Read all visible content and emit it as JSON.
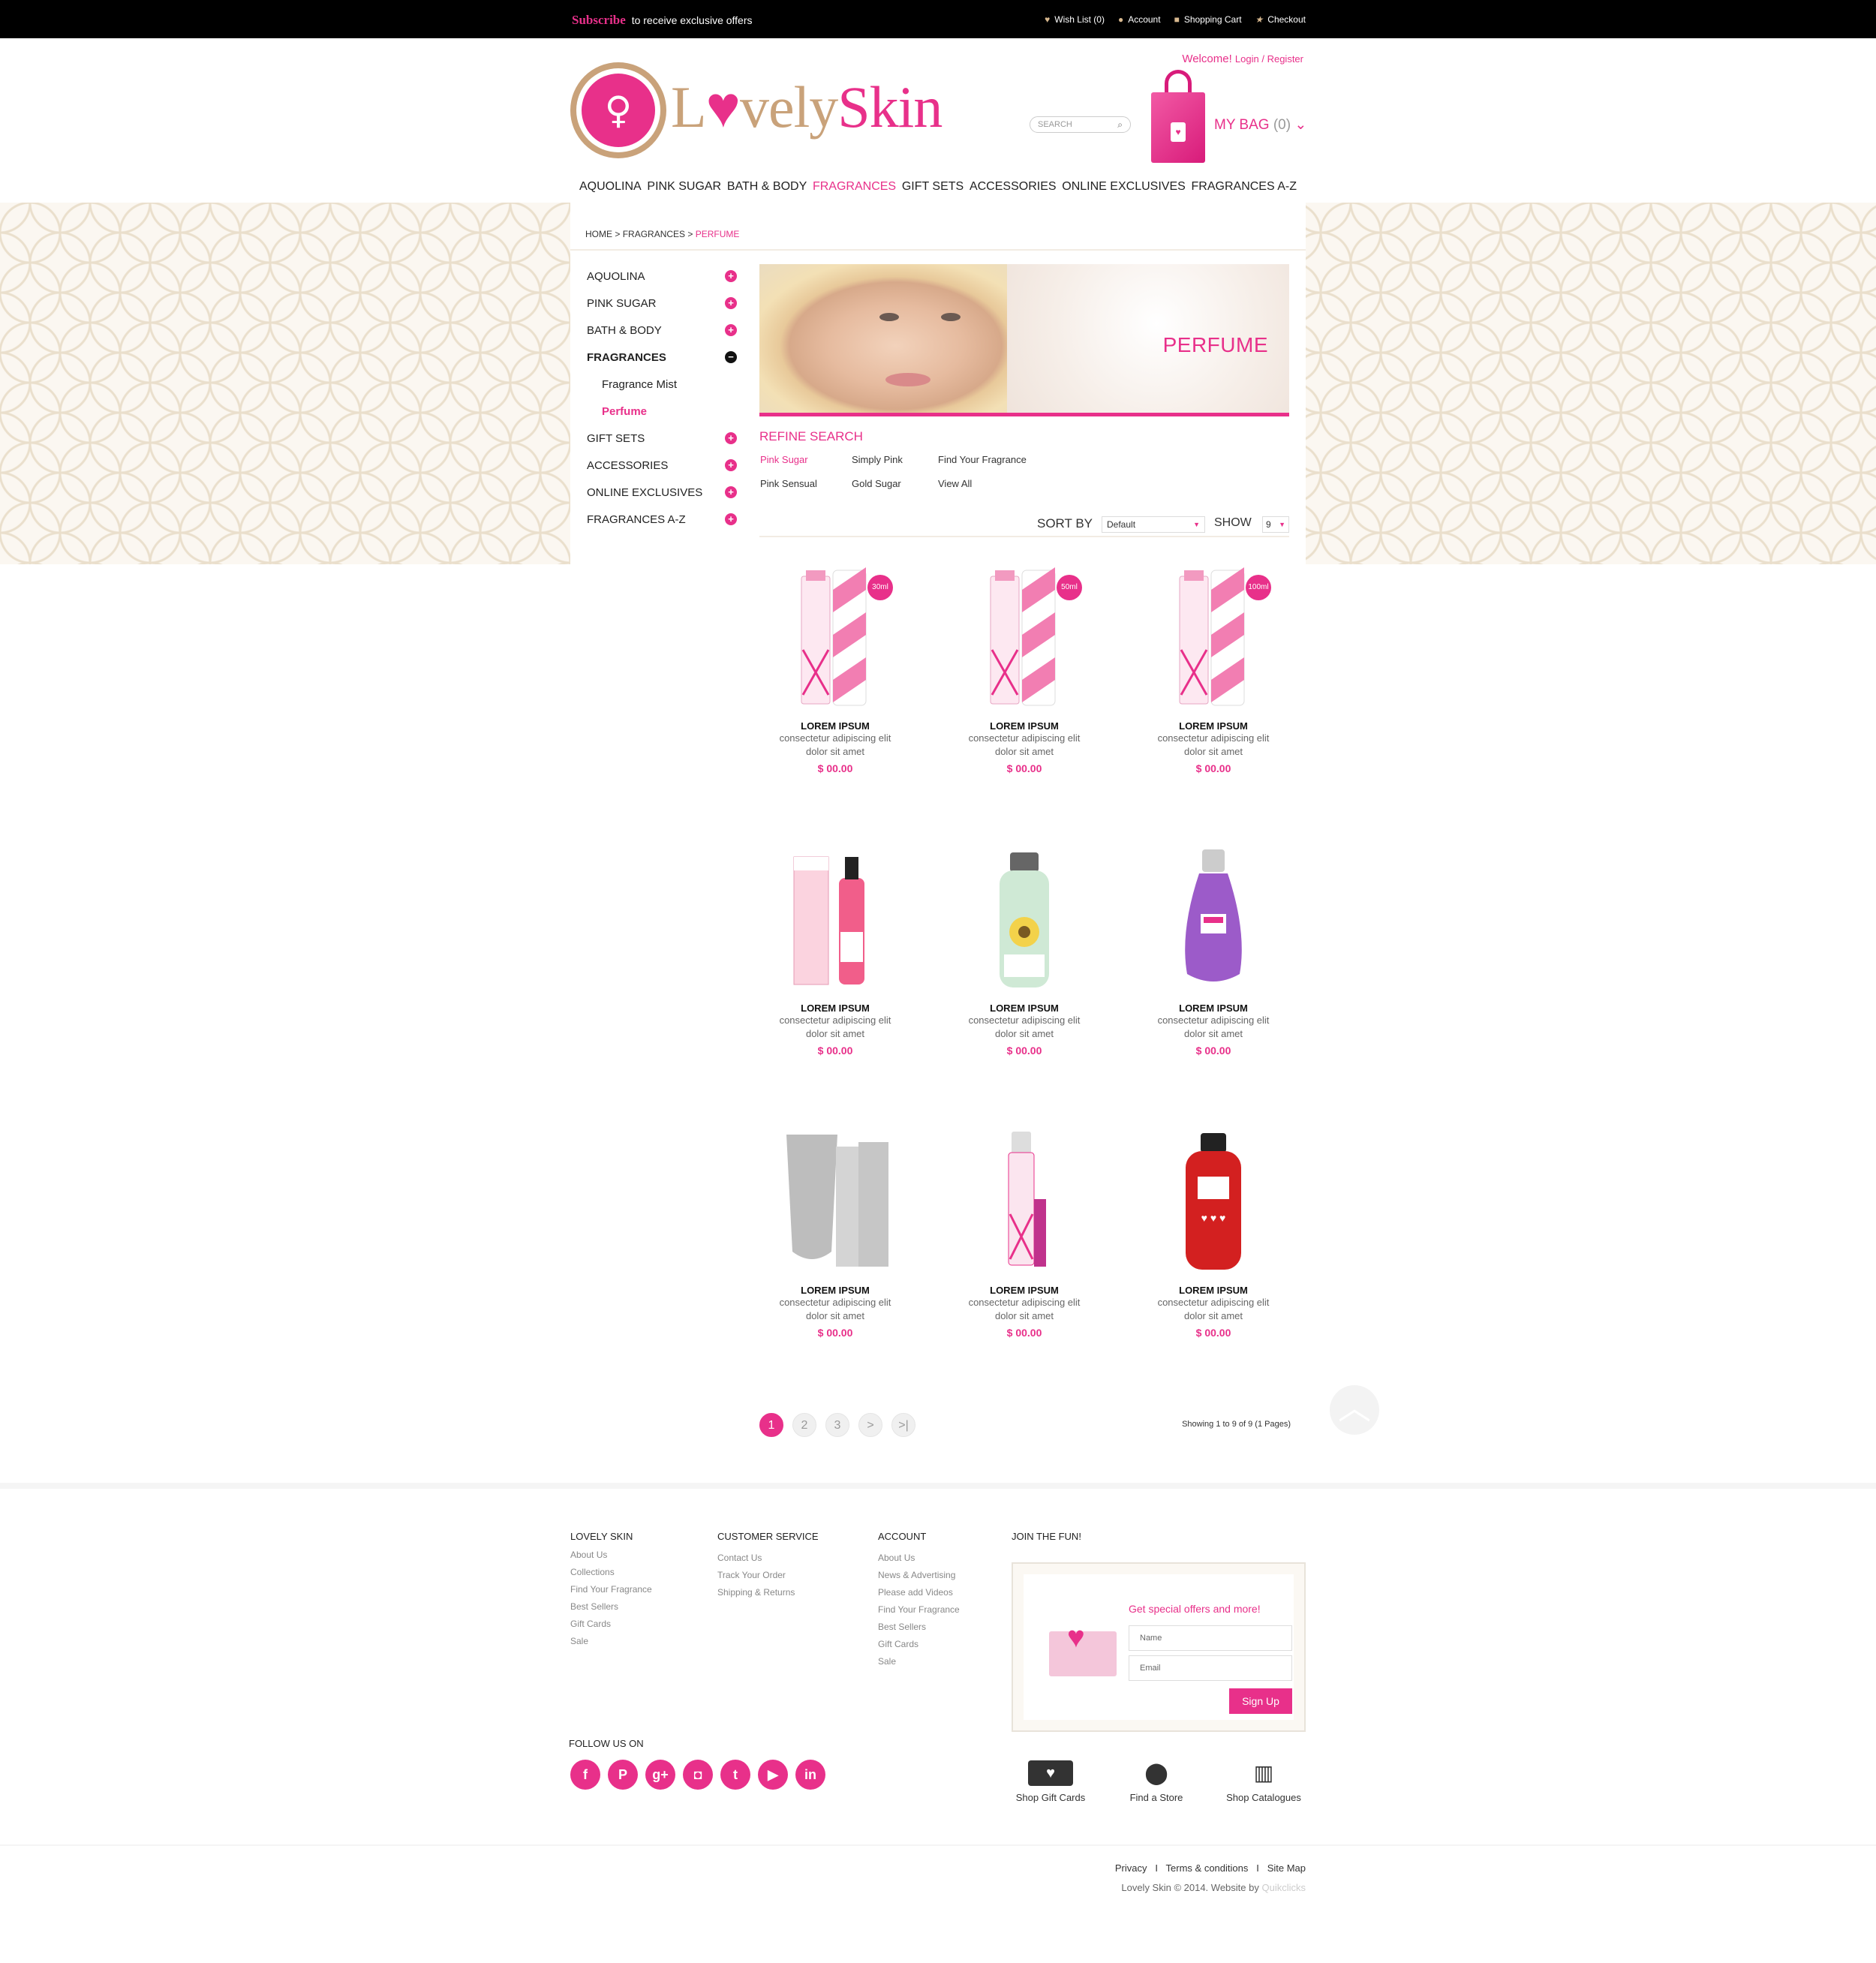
{
  "topbar": {
    "subscribe": "Subscribe",
    "subscribe_text": "to receive exclusive offers",
    "links": [
      {
        "label": "Wish List (0)",
        "icon": "heart-icon"
      },
      {
        "label": "Account",
        "icon": "user-icon"
      },
      {
        "label": "Shopping Cart",
        "icon": "cart-icon"
      },
      {
        "label": "Checkout",
        "icon": "star-icon"
      }
    ]
  },
  "header": {
    "logo_text_1": "L",
    "logo_text_o": "♥",
    "logo_text_2": "vely",
    "logo_text_3": "Skin",
    "welcome": "Welcome!",
    "login": "Login",
    "register": "Register",
    "search_placeholder": "SEARCH",
    "mybag": "MY BAG",
    "bag_count": "(0)"
  },
  "nav": [
    "AQUOLINA",
    "PINK SUGAR",
    "BATH & BODY",
    "FRAGRANCES",
    "GIFT SETS",
    "ACCESSORIES",
    "ONLINE EXCLUSIVES",
    "FRAGRANCES A-Z"
  ],
  "nav_active": "FRAGRANCES",
  "breadcrumb": {
    "home": "HOME",
    "sep": ">",
    "mid": "FRAGRANCES",
    "current": "PERFUME"
  },
  "sidebar": [
    {
      "label": "AQUOLINA",
      "state": "plus"
    },
    {
      "label": "PINK SUGAR",
      "state": "plus"
    },
    {
      "label": "BATH & BODY",
      "state": "plus"
    },
    {
      "label": "FRAGRANCES",
      "state": "minus"
    },
    {
      "label": "Fragrance Mist",
      "state": "sub"
    },
    {
      "label": "Perfume",
      "state": "sub-active"
    },
    {
      "label": "GIFT SETS",
      "state": "plus"
    },
    {
      "label": "ACCESSORIES",
      "state": "plus"
    },
    {
      "label": "ONLINE EXCLUSIVES",
      "state": "plus"
    },
    {
      "label": "FRAGRANCES A-Z",
      "state": "plus"
    }
  ],
  "banner": {
    "title": "PERFUME"
  },
  "refine": {
    "title": "REFINE SEARCH",
    "links": [
      "Pink Sugar",
      "Simply Pink",
      "Find Your Fragrance",
      "Pink Sensual",
      "Gold Sugar",
      "View All"
    ]
  },
  "sort": {
    "label": "SORT BY",
    "value": "Default",
    "show_label": "SHOW",
    "show_value": "9"
  },
  "products": [
    {
      "name": "LOREM IPSUM",
      "desc1": "consectetur adipiscing elit",
      "desc2": "dolor sit amet",
      "price": "$ 00.00",
      "badge": "30ml",
      "kind": "pink-sugar"
    },
    {
      "name": "LOREM IPSUM",
      "desc1": "consectetur adipiscing elit",
      "desc2": "dolor sit amet",
      "price": "$ 00.00",
      "badge": "50ml",
      "kind": "pink-sugar"
    },
    {
      "name": "LOREM IPSUM",
      "desc1": "consectetur adipiscing elit",
      "desc2": "dolor sit amet",
      "price": "$ 00.00",
      "badge": "100ml",
      "kind": "pink-sugar"
    },
    {
      "name": "LOREM IPSUM",
      "desc1": "consectetur adipiscing elit",
      "desc2": "dolor sit amet",
      "price": "$ 00.00",
      "badge": "",
      "kind": "mist"
    },
    {
      "name": "LOREM IPSUM",
      "desc1": "consectetur adipiscing elit",
      "desc2": "dolor sit amet",
      "price": "$ 00.00",
      "badge": "",
      "kind": "lotion"
    },
    {
      "name": "LOREM IPSUM",
      "desc1": "consectetur adipiscing elit",
      "desc2": "dolor sit amet",
      "price": "$ 00.00",
      "badge": "",
      "kind": "purple"
    },
    {
      "name": "LOREM IPSUM",
      "desc1": "consectetur adipiscing elit",
      "desc2": "dolor sit amet",
      "price": "$ 00.00",
      "badge": "",
      "kind": "steel"
    },
    {
      "name": "LOREM IPSUM",
      "desc1": "consectetur adipiscing elit",
      "desc2": "dolor sit amet",
      "price": "$ 00.00",
      "badge": "",
      "kind": "spray"
    },
    {
      "name": "LOREM IPSUM",
      "desc1": "consectetur adipiscing elit",
      "desc2": "dolor sit amet",
      "price": "$ 00.00",
      "badge": "",
      "kind": "red"
    }
  ],
  "pagination": {
    "pages": [
      "1",
      "2",
      "3",
      ">",
      ">|"
    ],
    "current": "1",
    "showing": "Showing 1 to 9 of 9 (1 Pages)"
  },
  "footer": {
    "col1": {
      "title": "LOVELY SKIN",
      "links": [
        "About Us",
        "Collections",
        "Find Your Fragrance",
        "Best Sellers",
        "Gift Cards",
        "Sale"
      ]
    },
    "col2": {
      "title": "CUSTOMER SERVICE",
      "links": [
        "Contact Us",
        "Track Your Order",
        "Shipping & Returns"
      ]
    },
    "col3": {
      "title": "ACCOUNT",
      "links": [
        "About Us",
        "News & Advertising",
        "Please add Videos",
        "Find Your Fragrance",
        "Best Sellers",
        "Gift Cards",
        "Sale"
      ]
    },
    "join": {
      "title": "JOIN THE FUN!",
      "text": "Get special offers and more!",
      "name_ph": "Name",
      "email_ph": "Email",
      "button": "Sign Up"
    },
    "follow": "FOLLOW US ON",
    "social": [
      {
        "icon": "facebook-icon",
        "glyph": "f"
      },
      {
        "icon": "pinterest-icon",
        "glyph": "P"
      },
      {
        "icon": "googleplus-icon",
        "glyph": "g+"
      },
      {
        "icon": "instagram-icon",
        "glyph": "◘"
      },
      {
        "icon": "twitter-icon",
        "glyph": "t"
      },
      {
        "icon": "youtube-icon",
        "glyph": "▶"
      },
      {
        "icon": "linkedin-icon",
        "glyph": "in"
      }
    ],
    "shortcuts": [
      {
        "label": "Shop Gift Cards",
        "icon": "gift-card-icon"
      },
      {
        "label": "Find a Store",
        "icon": "map-pin-icon"
      },
      {
        "label": "Shop Catalogues",
        "icon": "book-icon"
      }
    ],
    "legal": [
      "Privacy",
      "Terms & conditions",
      "Site Map"
    ],
    "legal_sep": "I",
    "copyright": "Lovely Skin © 2014. Website by",
    "credit": "Quikclicks"
  },
  "colors": {
    "accent": "#e8308a",
    "gold": "#c9a27a",
    "black": "#000000"
  }
}
